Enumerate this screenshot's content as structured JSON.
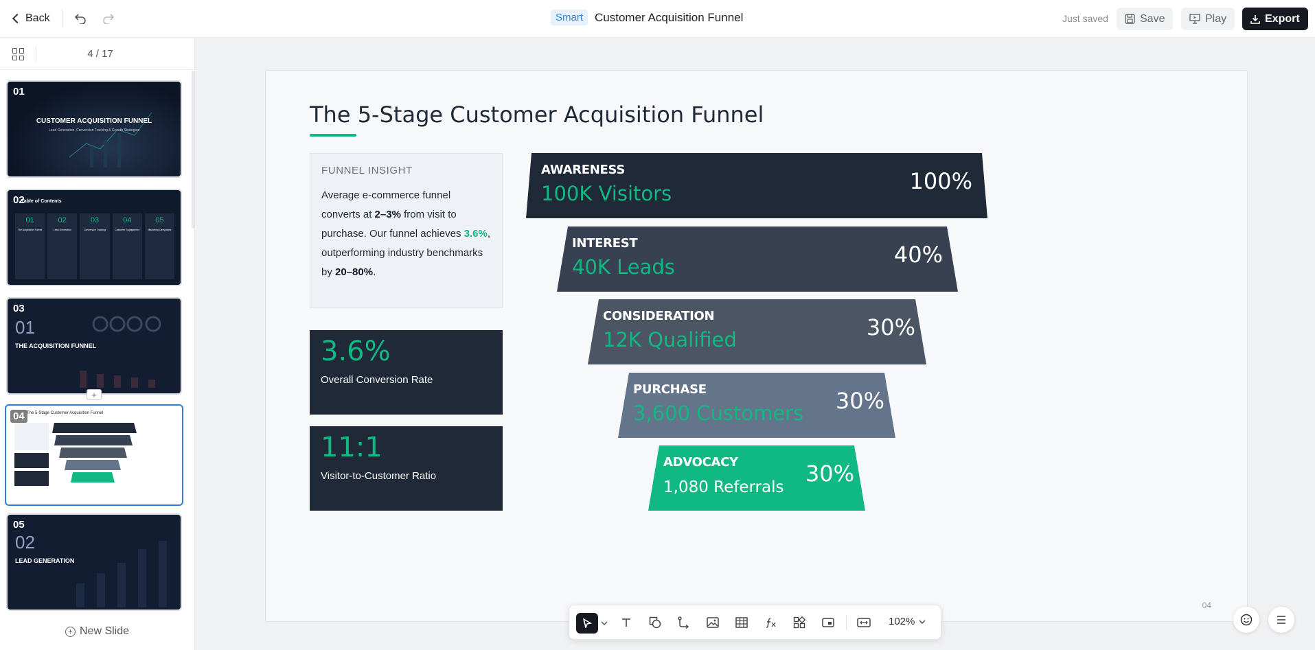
{
  "header": {
    "back_label": "Back",
    "badge": "Smart",
    "title": "Customer Acquisition Funnel",
    "saved_status": "Just saved",
    "save_label": "Save",
    "play_label": "Play",
    "export_label": "Export"
  },
  "sidebar": {
    "page_counter": "4 / 17",
    "new_slide_label": "New Slide",
    "add_between": "+",
    "thumbnails": [
      {
        "num": "01",
        "title": "CUSTOMER ACQUISITION FUNNEL",
        "subtitle": "Lead Generation, Conversion Tracking & Growth Strategies"
      },
      {
        "num": "02",
        "title": "Table of Contents",
        "cols": [
          "01",
          "02",
          "03",
          "04",
          "05"
        ],
        "col_labels": [
          "The Acquisition Funnel",
          "Lead Generation",
          "Conversion Tracking",
          "Customer Engagement",
          "Marketing Campaigns"
        ]
      },
      {
        "num": "03",
        "bignum": "01",
        "title": "THE ACQUISITION FUNNEL"
      },
      {
        "num": "04",
        "title": "The 5-Stage Customer Acquisition Funnel",
        "active": true
      },
      {
        "num": "05",
        "bignum": "02",
        "title": "LEAD GENERATION"
      }
    ]
  },
  "slide": {
    "title": "The 5-Stage Customer Acquisition Funnel",
    "insight": {
      "heading": "FUNNEL INSIGHT",
      "t1": "Average e-commerce funnel converts at ",
      "b1": "2–3%",
      "t2": " from visit to purchase. Our funnel achieves ",
      "g1": "3.6%",
      "t3": ", outperforming industry benchmarks by ",
      "b2": "20–80%",
      "t4": "."
    },
    "stats": [
      {
        "value": "3.6%",
        "label": "Overall Conversion Rate"
      },
      {
        "value": "11:1",
        "label": "Visitor-to-Customer Ratio"
      }
    ],
    "stages": [
      {
        "name": "AWARENESS",
        "value": "100K Visitors",
        "pct": "100%",
        "color": "#1f2937",
        "value_color": "#10b981"
      },
      {
        "name": "INTEREST",
        "value": "40K Leads",
        "pct": "40%",
        "color": "#374151",
        "value_color": "#10b981"
      },
      {
        "name": "CONSIDERATION",
        "value": "12K Qualified",
        "pct": "30%",
        "color": "#4b5563",
        "value_color": "#10b981"
      },
      {
        "name": "PURCHASE",
        "value": "3,600 Customers",
        "pct": "30%",
        "color": "#64748b",
        "value_color": "#10b981"
      },
      {
        "name": "ADVOCACY",
        "value": "1,080 Referrals",
        "pct": "30%",
        "color": "#10b981",
        "value_color": "#ffffff"
      }
    ],
    "page_number": "04"
  },
  "toolbar": {
    "zoom": "102%"
  }
}
